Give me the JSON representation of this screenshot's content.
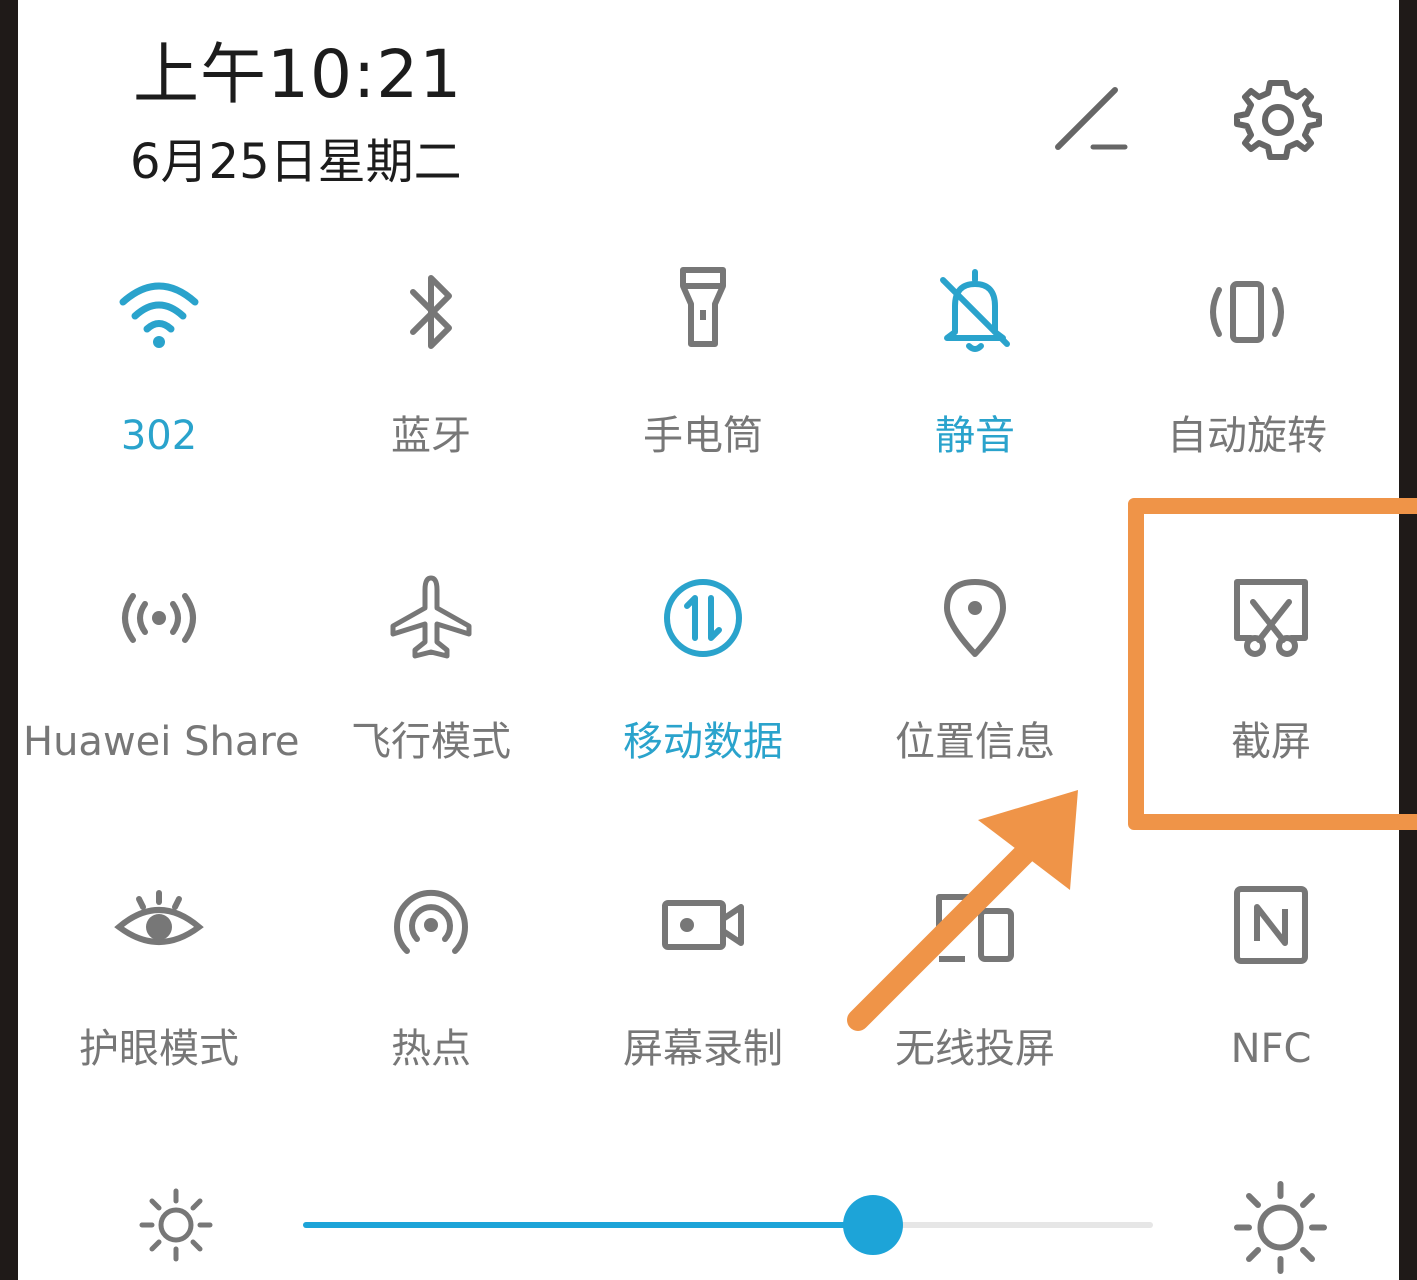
{
  "status": {
    "time": "上午10:21",
    "date": "6月25日星期二"
  },
  "header": {
    "edit_icon": "pencil-icon",
    "settings_icon": "gear-icon"
  },
  "tiles": [
    {
      "label": "302",
      "icon": "wifi-icon",
      "active": true
    },
    {
      "label": "蓝牙",
      "icon": "bluetooth-icon",
      "active": false
    },
    {
      "label": "手电筒",
      "icon": "flashlight-icon",
      "active": false
    },
    {
      "label": "静音",
      "icon": "bell-off-icon",
      "active": true
    },
    {
      "label": "自动旋转",
      "icon": "auto-rotate-icon",
      "active": false
    },
    {
      "label": "Huawei Share",
      "icon": "broadcast-icon",
      "active": false
    },
    {
      "label": "飞行模式",
      "icon": "airplane-icon",
      "active": false
    },
    {
      "label": "移动数据",
      "icon": "mobile-data-icon",
      "active": true
    },
    {
      "label": "位置信息",
      "icon": "location-pin-icon",
      "active": false
    },
    {
      "label": "截屏",
      "icon": "screenshot-scissors-icon",
      "active": false
    },
    {
      "label": "护眼模式",
      "icon": "eye-icon",
      "active": false
    },
    {
      "label": "热点",
      "icon": "hotspot-icon",
      "active": false
    },
    {
      "label": "屏幕录制",
      "icon": "video-camera-icon",
      "active": false
    },
    {
      "label": "无线投屏",
      "icon": "cast-screen-icon",
      "active": false
    },
    {
      "label": "NFC",
      "icon": "nfc-icon",
      "active": false
    }
  ],
  "brightness": {
    "value_fraction": 0.67,
    "low_icon": "sun-small-icon",
    "high_icon": "sun-large-icon"
  },
  "annotation": {
    "highlight": "orange-highlight-box",
    "arrow": "orange-arrow",
    "color": "#ef9448"
  },
  "colors": {
    "accent": "#2aa3cc",
    "inactive": "#777777",
    "slider": "#1da4d8"
  }
}
